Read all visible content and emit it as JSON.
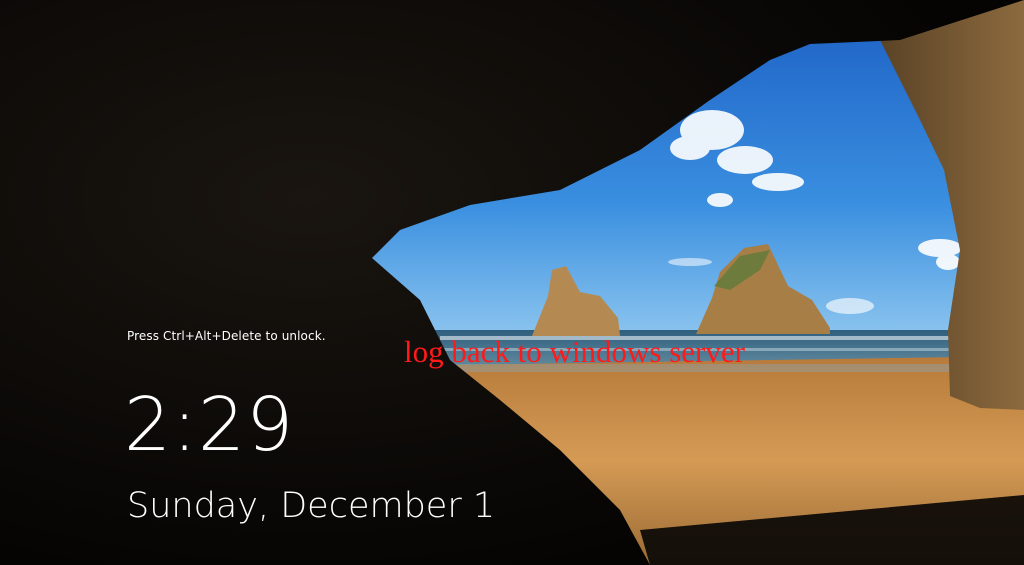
{
  "lock_screen": {
    "unlock_hint": "Press Ctrl+Alt+Delete to unlock.",
    "time": "2:29",
    "date": "Sunday, December 1"
  },
  "annotation": {
    "text": "log back to windows server",
    "color": "#ff1a1a"
  },
  "wallpaper": {
    "subject": "sea-cave-beach",
    "colors": {
      "sky": "#2f7fd8",
      "sea": "#3a6f8f",
      "sand": "#c98f4e",
      "rock": "#b08a52",
      "cave": "#0c0a08"
    }
  }
}
